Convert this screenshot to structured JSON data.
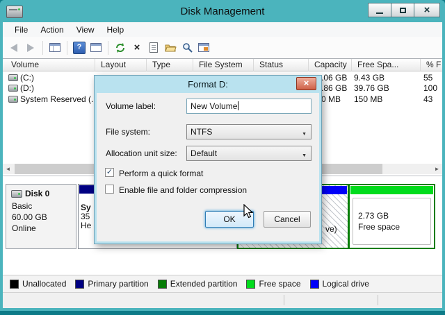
{
  "window": {
    "title": "Disk Management",
    "controls": {
      "close_glyph": "×"
    }
  },
  "menu": {
    "items": [
      "File",
      "Action",
      "View",
      "Help"
    ]
  },
  "toolbar": {
    "icons": [
      "back",
      "forward",
      "show-console-tree",
      "help",
      "show-action-pane",
      "refresh",
      "delete",
      "properties",
      "open",
      "search",
      "snap-in"
    ],
    "delete_glyph": "×",
    "help_glyph": "?"
  },
  "volume_table": {
    "columns": [
      "Volume",
      "Layout",
      "Type",
      "File System",
      "Status",
      "Capacity",
      "Free Spa...",
      "% F"
    ],
    "rows": [
      {
        "volume": "(C:)",
        "capacity_visible": ".06 GB",
        "free_space": "9.43 GB",
        "percent_free": "55"
      },
      {
        "volume": "(D:)",
        "capacity_visible": ".86 GB",
        "free_space": "39.76 GB",
        "percent_free": "100"
      },
      {
        "volume": "System Reserved (...",
        "capacity_visible": "0 MB",
        "free_space": "150 MB",
        "percent_free": "43"
      }
    ]
  },
  "dialog": {
    "title": "Format D:",
    "close_glyph": "×",
    "volume_label": {
      "label": "Volume label:",
      "value": "New Volume"
    },
    "file_system": {
      "label": "File system:",
      "value": "NTFS"
    },
    "allocation_unit": {
      "label": "Allocation unit size:",
      "value": "Default"
    },
    "checkboxes": [
      {
        "label": "Perform a quick format",
        "checked": true,
        "mark": "✓"
      },
      {
        "label": "Enable file and folder compression",
        "checked": false,
        "mark": ""
      }
    ],
    "buttons": {
      "ok": "OK",
      "cancel": "Cancel"
    }
  },
  "disk_view": {
    "disk": {
      "name": "Disk 0",
      "type": "Basic",
      "size": "60.00 GB",
      "status": "Online"
    },
    "system_reserved_partition": {
      "bar_color": "#000082",
      "fragment_line1": "Sy",
      "fragment_line2": "35",
      "fragment_line3": "He"
    },
    "logical_partition": {
      "bar_color": "#0000f8",
      "text_fragment": "ve)"
    },
    "free_space_partition": {
      "bar_color": "#00dc1c",
      "size": "2.73 GB",
      "label": "Free space"
    },
    "extended_border_color": "#077d07"
  },
  "legend": {
    "items": [
      {
        "label": "Unallocated",
        "color": "#000000"
      },
      {
        "label": "Primary partition",
        "color": "#000082"
      },
      {
        "label": "Extended partition",
        "color": "#077d07"
      },
      {
        "label": "Free space",
        "color": "#00dc1c"
      },
      {
        "label": "Logical drive",
        "color": "#0000f8"
      }
    ]
  },
  "icons": {
    "combo_arrow": "▼",
    "scroll_left": "◄",
    "scroll_right": "►"
  }
}
